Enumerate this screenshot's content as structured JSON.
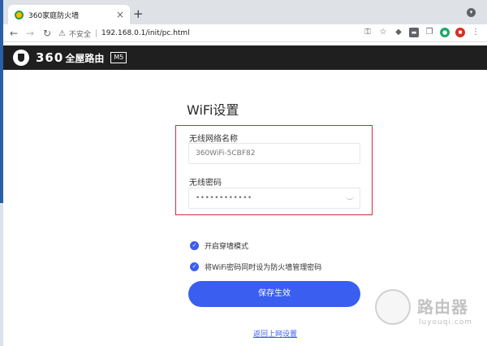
{
  "browser": {
    "tab_title": "360家庭防火墙",
    "tab_close": "×",
    "new_tab": "+",
    "insecure_label": "不安全",
    "url": "192.168.0.1/init/pc.html"
  },
  "router": {
    "brand": "360",
    "brand_sub": "全屋路由",
    "model": "M5"
  },
  "form": {
    "title": "WiFi设置",
    "ssid_label": "无线网络名称",
    "ssid_value": "360WiFi-5CBF82",
    "password_label": "无线密码",
    "password_value": "••••••••••••",
    "checkbox1_label": "开启穿墙模式",
    "checkbox2_label": "将WiFi密码同时设为防火墙管理密码",
    "save_label": "保存生效",
    "back_label": "返回上网设置"
  },
  "watermark": {
    "text": "路由器",
    "sub": "luyouqi.com"
  },
  "colors": {
    "accent": "#3a5ef0",
    "highlight": "#d8283c",
    "header_bg": "#1f1f1f"
  }
}
